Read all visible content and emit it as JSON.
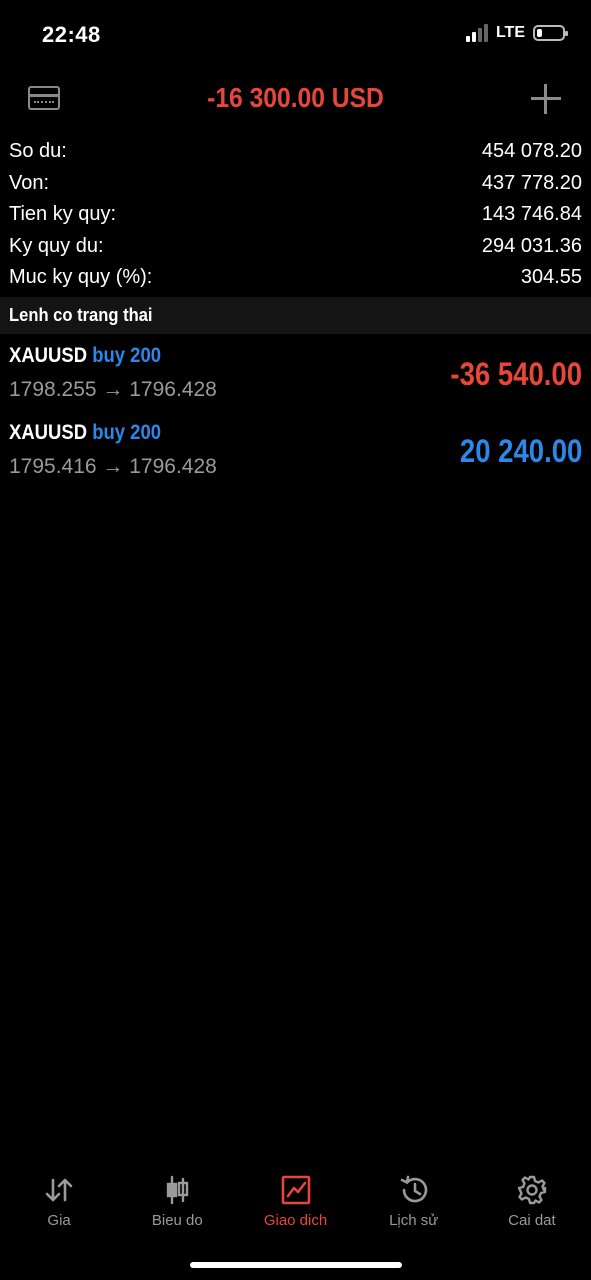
{
  "status_bar": {
    "time": "22:48",
    "network": "LTE"
  },
  "header": {
    "balance_total": "-16 300.00 USD",
    "balance_color": "#e8463a"
  },
  "summary": [
    {
      "label": "So du:",
      "value": "454 078.20"
    },
    {
      "label": "Von:",
      "value": "437 778.20"
    },
    {
      "label": "Tien ky quy:",
      "value": "143 746.84"
    },
    {
      "label": "Ky quy du:",
      "value": "294 031.36"
    },
    {
      "label": "Muc ky quy (%):",
      "value": "304.55"
    }
  ],
  "positions_section": {
    "title": "Lenh co trang thai"
  },
  "positions": [
    {
      "symbol": "XAUUSD",
      "side": "buy 200",
      "prices": "1798.255 → 1796.428",
      "profit": "-36 540.00",
      "profit_color": "#e8463a"
    },
    {
      "symbol": "XAUUSD",
      "side": "buy 200",
      "prices": "1795.416 → 1796.428",
      "profit": "20 240.00",
      "profit_color": "#2b87e8"
    }
  ],
  "tabs": [
    {
      "label": "Gia",
      "icon": "arrows-up-down-icon",
      "active": false
    },
    {
      "label": "Bieu do",
      "icon": "candlestick-icon",
      "active": false
    },
    {
      "label": "Giao dich",
      "icon": "trade-chart-icon",
      "active": true
    },
    {
      "label": "Lịch sử",
      "icon": "history-icon",
      "active": false
    },
    {
      "label": "Cai dat",
      "icon": "gear-icon",
      "active": false
    }
  ],
  "colors": {
    "accent_red": "#e8463a",
    "accent_blue": "#2b87e8",
    "muted": "#9a9a9a"
  }
}
